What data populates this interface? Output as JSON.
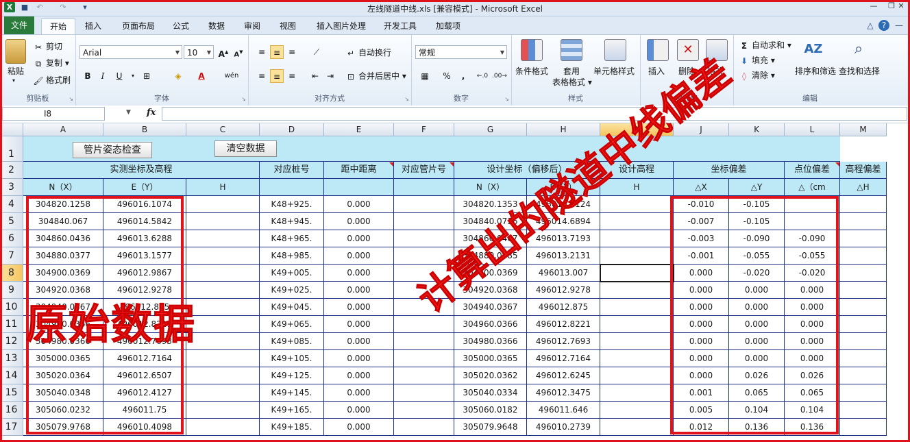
{
  "window": {
    "title": "左线隧道中线.xls  [兼容模式] - Microsoft Excel"
  },
  "tabs": {
    "file": "文件",
    "items": [
      "开始",
      "插入",
      "页面布局",
      "公式",
      "数据",
      "审阅",
      "视图",
      "插入图片处理",
      "开发工具",
      "加载项"
    ]
  },
  "ribbon": {
    "clipboard": {
      "paste": "粘贴",
      "cut": "剪切",
      "copy": "复制",
      "format_painter": "格式刷",
      "label": "剪贴板"
    },
    "font": {
      "name": "Arial",
      "size": "10",
      "bold": "B",
      "italic": "I",
      "underline": "U",
      "label": "字体",
      "grow": "A",
      "shrink": "A",
      "wen": "wén"
    },
    "align": {
      "wrap": "自动换行",
      "merge": "合并后居中",
      "label": "对齐方式"
    },
    "number": {
      "format": "常规",
      "percent": "%",
      "comma": ",",
      "label": "数字"
    },
    "styles": {
      "cond": "条件格式",
      "table_1": "套用",
      "table_2": "表格格式",
      "cell_style": "单元格样式",
      "label": "样式"
    },
    "cells": {
      "insert": "插入",
      "delete": "删除",
      "format": "格式",
      "label": "单元格"
    },
    "editing": {
      "autosum": "自动求和",
      "fill": "填充",
      "clear": "清除",
      "sort": "排序和筛选",
      "find": "查找和选择",
      "label": "编辑"
    }
  },
  "formula_bar": {
    "name_box": "I8",
    "fx": "fx",
    "value": ""
  },
  "columns": [
    "A",
    "B",
    "C",
    "D",
    "E",
    "F",
    "G",
    "H",
    "I",
    "J",
    "K",
    "L",
    "M"
  ],
  "selected_column": "I",
  "selected_row": "8",
  "rows_numbers": [
    "1",
    "2",
    "3",
    "4",
    "5",
    "6",
    "7",
    "8",
    "9",
    "10",
    "11",
    "12",
    "13",
    "14",
    "15",
    "16",
    "17"
  ],
  "sheet_buttons": {
    "check": "管片姿态检查",
    "clear": "清空数据"
  },
  "header_row2": {
    "measured": "实测坐标及高程",
    "station": "对应桩号",
    "dist": "距中距离",
    "segment": "对应管片号",
    "design": "设计坐标（偏移后）",
    "design_h": "设计高程",
    "coord_dev": "坐标偏差",
    "point_dev": "点位偏差",
    "elev_dev": "高程偏差"
  },
  "header_row3": [
    "N（X）",
    "E（Y）",
    "H",
    "",
    "",
    "",
    "N（X）",
    "E（Y）",
    "H",
    "△X",
    "△Y",
    "△（cm",
    "△H"
  ],
  "data_rows": [
    [
      "304820.1258",
      "496016.1074",
      "",
      "K48+925.",
      "0.000",
      "",
      "304820.1353",
      "496016.2124",
      "",
      "-0.010",
      "-0.105",
      "",
      ""
    ],
    [
      "304840.067",
      "496014.5842",
      "",
      "K48+945.",
      "0.000",
      "",
      "304840.0736",
      "496014.6894",
      "",
      "-0.007",
      "-0.105",
      "",
      ""
    ],
    [
      "304860.0436",
      "496013.6288",
      "",
      "K48+965.",
      "0.000",
      "",
      "304860.0467",
      "496013.7193",
      "",
      "-0.003",
      "-0.090",
      "-0.090",
      ""
    ],
    [
      "304880.0377",
      "496013.1577",
      "",
      "K48+985.",
      "0.000",
      "",
      "304880.0385",
      "496013.2131",
      "",
      "-0.001",
      "-0.055",
      "-0.055",
      ""
    ],
    [
      "304900.0369",
      "496012.9867",
      "",
      "K49+005.",
      "0.000",
      "",
      "304900.0369",
      "496013.007",
      "",
      "0.000",
      "-0.020",
      "-0.020",
      ""
    ],
    [
      "304920.0368",
      "496012.9278",
      "",
      "K49+025.",
      "0.000",
      "",
      "304920.0368",
      "496012.9278",
      "",
      "0.000",
      "0.000",
      "0.000",
      ""
    ],
    [
      "304940.0367",
      "496012.875",
      "",
      "K49+045.",
      "0.000",
      "",
      "304940.0367",
      "496012.875",
      "",
      "0.000",
      "0.000",
      "0.000",
      ""
    ],
    [
      "304960.0366",
      "496012.8221",
      "",
      "K49+065.",
      "0.000",
      "",
      "304960.0366",
      "496012.8221",
      "",
      "0.000",
      "0.000",
      "0.000",
      ""
    ],
    [
      "304980.0366",
      "496012.7693",
      "",
      "K49+085.",
      "0.000",
      "",
      "304980.0366",
      "496012.7693",
      "",
      "0.000",
      "0.000",
      "0.000",
      ""
    ],
    [
      "305000.0365",
      "496012.7164",
      "",
      "K49+105.",
      "0.000",
      "",
      "305000.0365",
      "496012.7164",
      "",
      "0.000",
      "0.000",
      "0.000",
      ""
    ],
    [
      "305020.0364",
      "496012.6507",
      "",
      "K49+125.",
      "0.000",
      "",
      "305020.0362",
      "496012.6245",
      "",
      "0.000",
      "0.026",
      "0.026",
      ""
    ],
    [
      "305040.0348",
      "496012.4127",
      "",
      "K49+145.",
      "0.000",
      "",
      "305040.0334",
      "496012.3475",
      "",
      "0.001",
      "0.065",
      "0.065",
      ""
    ],
    [
      "305060.0232",
      "496011.75",
      "",
      "K49+165.",
      "0.000",
      "",
      "305060.0182",
      "496011.646",
      "",
      "0.005",
      "0.104",
      "0.104",
      ""
    ],
    [
      "305079.9768",
      "496010.4098",
      "",
      "K49+185.",
      "0.000",
      "",
      "305079.9648",
      "496010.2739",
      "",
      "0.012",
      "0.136",
      "0.136",
      ""
    ]
  ],
  "annotations": {
    "left": "原始数据",
    "right": "计算出的隧道中线偏差"
  },
  "colors": {
    "accent_red": "#e0121b",
    "header_fill": "#bde9f7",
    "file_tab": "#2a7a3b"
  }
}
